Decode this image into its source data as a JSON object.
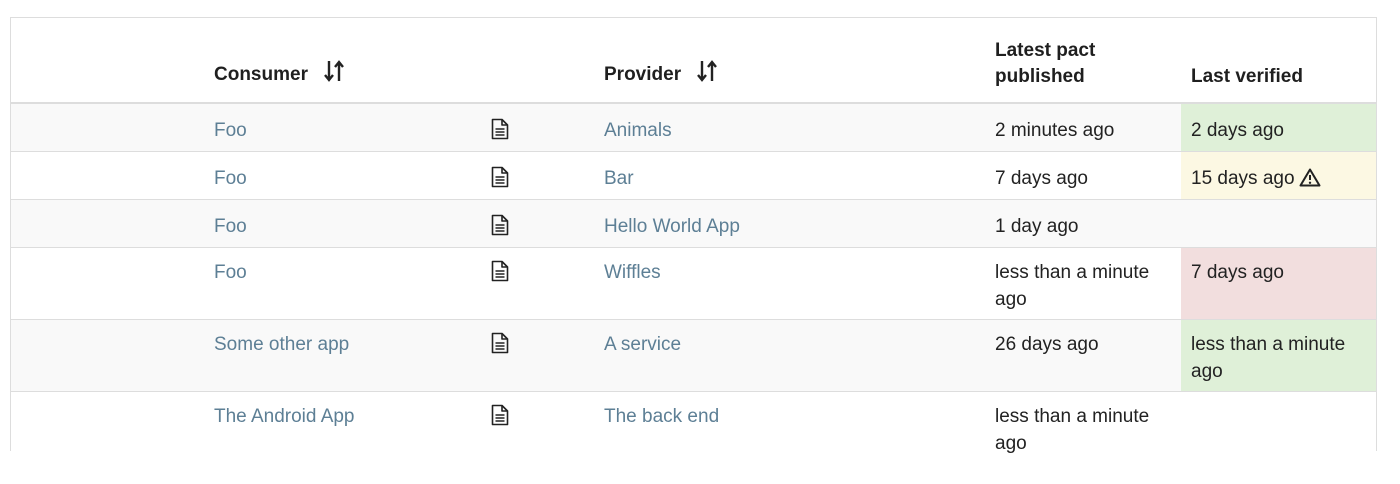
{
  "table": {
    "headers": {
      "consumer": "Consumer",
      "provider": "Provider",
      "latest_pact_published": "Latest pact published",
      "last_verified": "Last verified"
    },
    "rows": [
      {
        "consumer": "Foo",
        "provider": "Animals",
        "published": "2 minutes ago",
        "verified": "2 days ago",
        "status": "success",
        "warning": false
      },
      {
        "consumer": "Foo",
        "provider": "Bar",
        "published": "7 days ago",
        "verified": "15 days ago",
        "status": "warning",
        "warning": true
      },
      {
        "consumer": "Foo",
        "provider": "Hello World App",
        "published": "1 day ago",
        "verified": "",
        "status": "none",
        "warning": false
      },
      {
        "consumer": "Foo",
        "provider": "Wiffles",
        "published": "less than a minute ago",
        "verified": "7 days ago",
        "status": "danger",
        "warning": false
      },
      {
        "consumer": "Some other app",
        "provider": "A service",
        "published": "26 days ago",
        "verified": "less than a minute ago",
        "status": "success",
        "warning": false
      },
      {
        "consumer": "The Android App",
        "provider": "The back end",
        "published": "less than a minute ago",
        "verified": "",
        "status": "none",
        "warning": false
      }
    ]
  },
  "icons": {
    "sort": "sort-up-down-icon",
    "document": "document-icon",
    "warning": "warning-triangle-icon"
  },
  "colors": {
    "link": "#5d7f95",
    "success_bg": "#dff0d8",
    "warning_bg": "#fcf8e3",
    "danger_bg": "#f2dede",
    "stripe_bg": "#f9f9f9"
  }
}
